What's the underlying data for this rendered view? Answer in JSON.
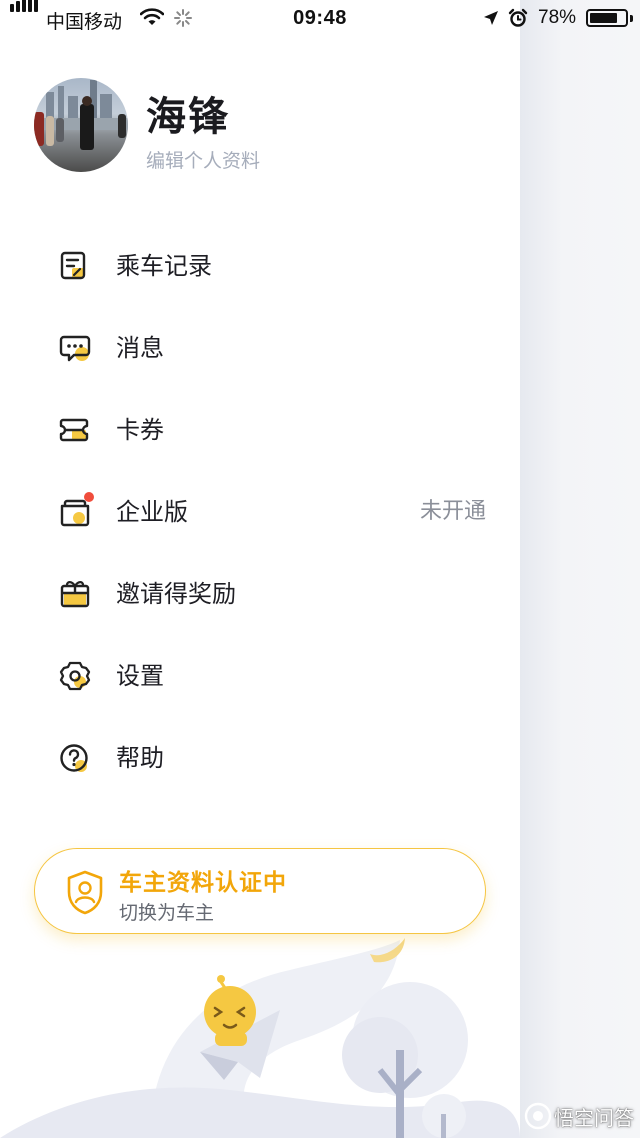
{
  "status_bar": {
    "carrier": "中国移动",
    "time": "09:48",
    "battery_percent": "78%",
    "battery_level": 0.78,
    "icons": [
      "signal-icon",
      "wifi-icon",
      "loading-icon",
      "location-arrow-icon",
      "alarm-icon",
      "battery-icon"
    ]
  },
  "profile": {
    "name": "海锋",
    "edit_label": "编辑个人资料"
  },
  "menu": [
    {
      "label": "乘车记录",
      "icon": "ride-record-icon"
    },
    {
      "label": "消息",
      "icon": "message-icon"
    },
    {
      "label": "卡券",
      "icon": "coupon-icon"
    },
    {
      "label": "企业版",
      "icon": "enterprise-icon",
      "status": "未开通",
      "badge": true
    },
    {
      "label": "邀请得奖励",
      "icon": "gift-icon"
    },
    {
      "label": "设置",
      "icon": "settings-icon"
    },
    {
      "label": "帮助",
      "icon": "help-icon"
    }
  ],
  "driver_card": {
    "title": "车主资料认证中",
    "subtitle": "切换为车主",
    "icon": "driver-shield-icon"
  },
  "watermark": {
    "text": "悟空问答",
    "icon": "wukong-logo-icon"
  },
  "colors": {
    "accent": "#f5c842",
    "accent_dark": "#f2a60a",
    "badge": "#f04d3c",
    "text": "#1e1e24",
    "muted": "#a6adbb"
  }
}
